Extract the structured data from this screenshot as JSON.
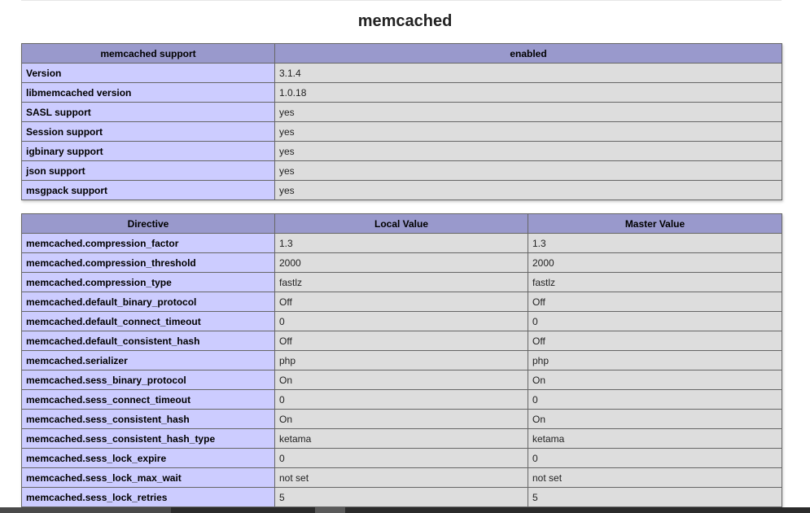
{
  "page": {
    "title": "memcached"
  },
  "support_table": {
    "header": {
      "col1": "memcached support",
      "col2": "enabled"
    },
    "rows": [
      {
        "name": "Version",
        "value": "3.1.4"
      },
      {
        "name": "libmemcached version",
        "value": "1.0.18"
      },
      {
        "name": "SASL support",
        "value": "yes"
      },
      {
        "name": "Session support",
        "value": "yes"
      },
      {
        "name": "igbinary support",
        "value": "yes"
      },
      {
        "name": "json support",
        "value": "yes"
      },
      {
        "name": "msgpack support",
        "value": "yes"
      }
    ]
  },
  "directive_table": {
    "header": {
      "col1": "Directive",
      "col2": "Local Value",
      "col3": "Master Value"
    },
    "rows": [
      {
        "name": "memcached.compression_factor",
        "local": "1.3",
        "master": "1.3"
      },
      {
        "name": "memcached.compression_threshold",
        "local": "2000",
        "master": "2000"
      },
      {
        "name": "memcached.compression_type",
        "local": "fastlz",
        "master": "fastlz"
      },
      {
        "name": "memcached.default_binary_protocol",
        "local": "Off",
        "master": "Off"
      },
      {
        "name": "memcached.default_connect_timeout",
        "local": "0",
        "master": "0"
      },
      {
        "name": "memcached.default_consistent_hash",
        "local": "Off",
        "master": "Off"
      },
      {
        "name": "memcached.serializer",
        "local": "php",
        "master": "php"
      },
      {
        "name": "memcached.sess_binary_protocol",
        "local": "On",
        "master": "On"
      },
      {
        "name": "memcached.sess_connect_timeout",
        "local": "0",
        "master": "0"
      },
      {
        "name": "memcached.sess_consistent_hash",
        "local": "On",
        "master": "On"
      },
      {
        "name": "memcached.sess_consistent_hash_type",
        "local": "ketama",
        "master": "ketama"
      },
      {
        "name": "memcached.sess_lock_expire",
        "local": "0",
        "master": "0"
      },
      {
        "name": "memcached.sess_lock_max_wait",
        "local": "not set",
        "master": "not set"
      },
      {
        "name": "memcached.sess_lock_retries",
        "local": "5",
        "master": "5"
      }
    ]
  },
  "colors": {
    "header_bg": "#9999cc",
    "key_bg": "#ccccff",
    "value_bg": "#dddddd",
    "border": "#666666"
  }
}
